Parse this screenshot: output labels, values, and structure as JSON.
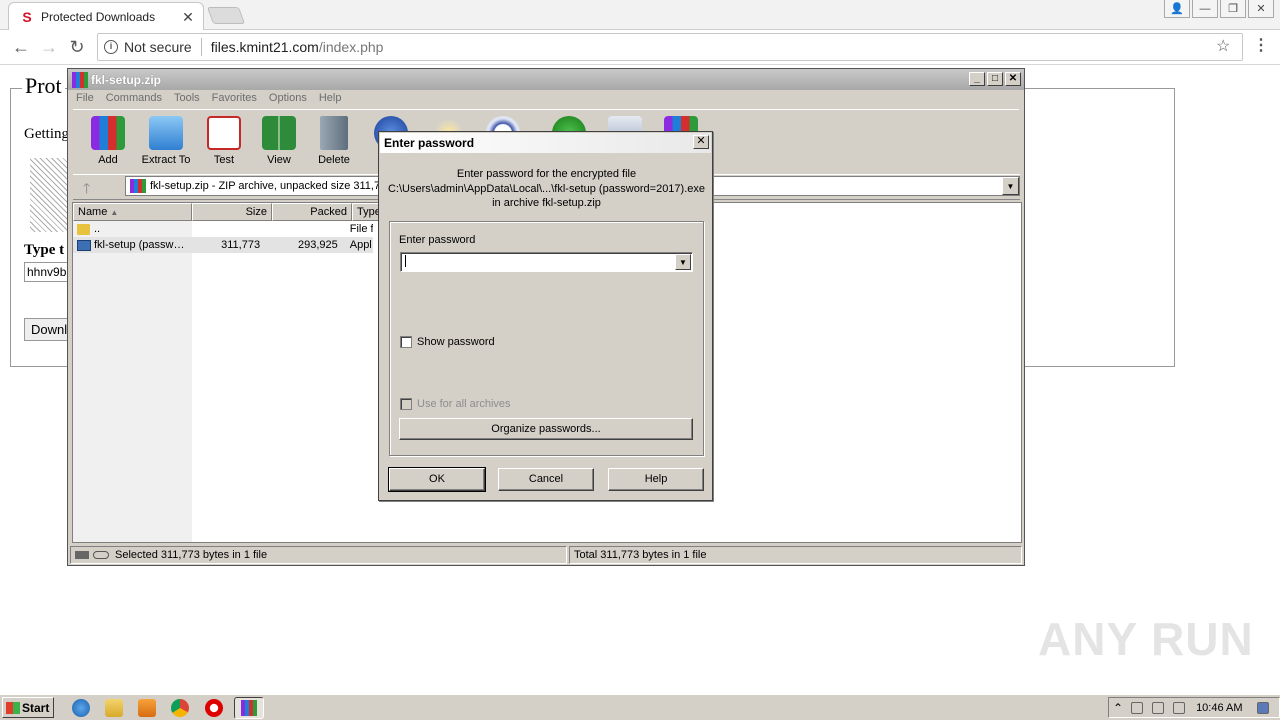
{
  "browser": {
    "tab_title": "Protected Downloads",
    "tab_favicon": "S",
    "url_security": "Not secure",
    "url_host": "files.kmint21.com",
    "url_path": "/index.php"
  },
  "page": {
    "legend": "Prot",
    "getting": "Getting",
    "type_label": "Type t",
    "input_value": "hhnv9b",
    "download_btn": "Downl"
  },
  "winrar": {
    "title": "fkl-setup.zip",
    "menu": [
      "File",
      "Commands",
      "Tools",
      "Favorites",
      "Options",
      "Help"
    ],
    "toolbar": [
      {
        "label": "Add",
        "icon": "add-archive-icon",
        "color": "#b33b8e"
      },
      {
        "label": "Extract To",
        "icon": "extract-folder-icon",
        "color": "#3d8fd8"
      },
      {
        "label": "Test",
        "icon": "test-clipboard-icon",
        "color": "#c62828"
      },
      {
        "label": "View",
        "icon": "view-book-icon",
        "color": "#2e8b3a"
      },
      {
        "label": "Delete",
        "icon": "delete-trash-icon",
        "color": "#7a8a99"
      }
    ],
    "address": "fkl-setup.zip - ZIP archive, unpacked size 311,77",
    "columns": [
      "Name",
      "Size",
      "Packed",
      "Type"
    ],
    "rows": [
      {
        "name": "..",
        "size": "",
        "packed": "",
        "type": "File f"
      },
      {
        "name": "fkl-setup (passw…",
        "size": "311,773",
        "packed": "293,925",
        "type": "Appl"
      }
    ],
    "status_left": "Selected 311,773 bytes in 1 file",
    "status_right": "Total 311,773 bytes in 1 file"
  },
  "dialog": {
    "title": "Enter password",
    "msg1": "Enter password for the encrypted file",
    "msg2": "C:\\Users\\admin\\AppData\\Local\\...\\fkl-setup (password=2017).exe",
    "msg3": "in archive fkl-setup.zip",
    "field_label": "Enter password",
    "password_value": "",
    "show_password": "Show password",
    "use_for_all": "Use for all archives",
    "organize": "Organize passwords...",
    "ok": "OK",
    "cancel": "Cancel",
    "help": "Help"
  },
  "taskbar": {
    "start": "Start",
    "clock": "10:46 AM"
  },
  "watermark": "ANY RUN"
}
